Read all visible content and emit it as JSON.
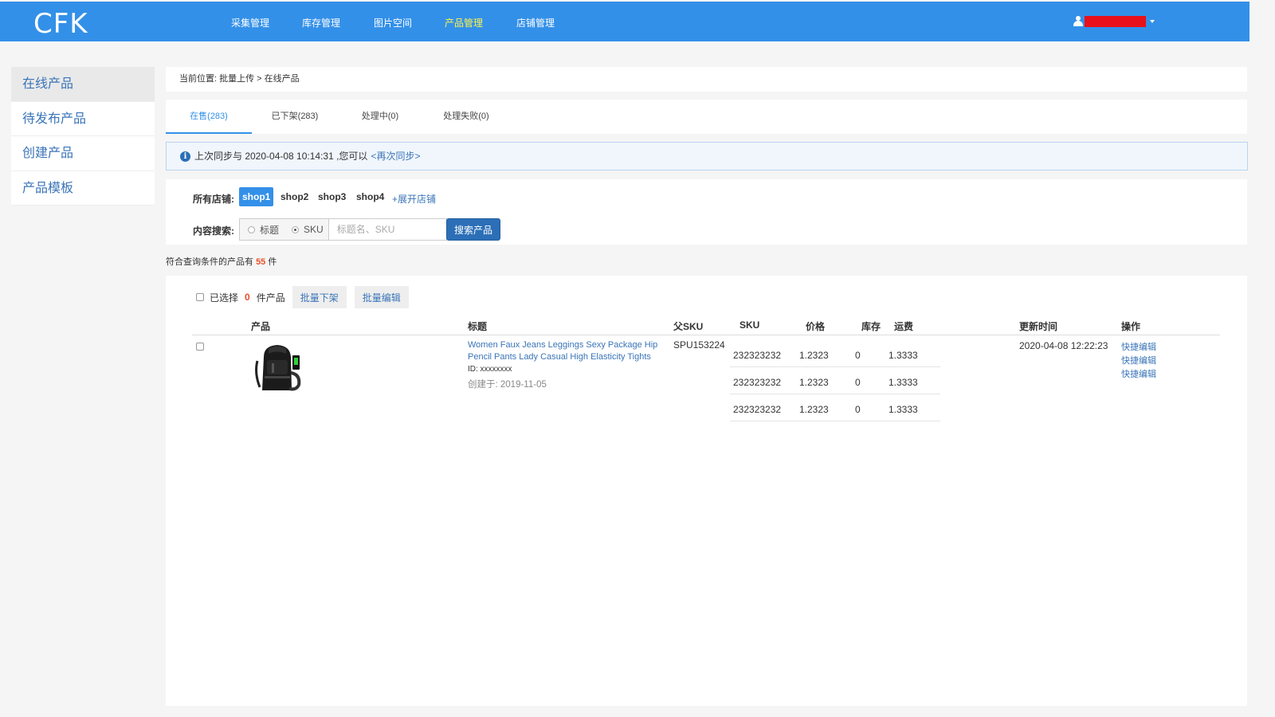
{
  "header": {
    "logo": "CFK",
    "nav": [
      "采集管理",
      "库存管理",
      "图片空间",
      "产品管理",
      "店铺管理"
    ],
    "active_nav": "产品管理"
  },
  "sidebar": {
    "items": [
      {
        "label": "在线产品",
        "active": true
      },
      {
        "label": "待发布产品",
        "active": false
      },
      {
        "label": "创建产品",
        "active": false
      },
      {
        "label": "产品模板",
        "active": false
      }
    ]
  },
  "breadcrumb": "当前位置: 批量上传 > 在线产品",
  "tabs": [
    "在售(283)",
    "已下架(283)",
    "处理中(0)",
    "处理失败(0)"
  ],
  "sync": {
    "icon": "info-icon",
    "text": "上次同步与 2020-04-08 10:14:31 ,您可以",
    "link": "<再次同步>"
  },
  "filters": {
    "shops_label": "所有店铺:",
    "shops": [
      "shop1",
      "shop2",
      "shop3",
      "shop4"
    ],
    "active_shop": "shop1",
    "expand_link": "+展开店铺",
    "search_label": "内容搜索:",
    "radio_title": "标题",
    "radio_sku": "SKU",
    "search_placeholder": "标题名、SKU",
    "search_button": "搜索产品"
  },
  "result": {
    "prefix": "符合查询条件的产品有",
    "count": "55",
    "suffix": "件"
  },
  "table": {
    "selected_prefix": "已选择",
    "selected_count": "0",
    "selected_suffix": "件产品",
    "batch_delist": "批量下架",
    "batch_edit": "批量编辑",
    "headers": {
      "product": "产品",
      "title": "标题",
      "parent_sku": "父SKU",
      "sku": "SKU",
      "price": "价格",
      "stock": "库存",
      "shipping": "运费",
      "updated": "更新时间",
      "action": "操作"
    },
    "rows": [
      {
        "image": "backpack-image",
        "title": "Women Faux Jeans Leggings Sexy Package Hip Pencil Pants Lady Casual High Elasticity Tights",
        "id": "ID: xxxxxxxx",
        "created": "创建于: 2019-11-05",
        "parent_sku": "SPU153224",
        "variants": [
          {
            "sku": "232323232",
            "price": "1.2323",
            "stock": "0",
            "shipping": "1.3333"
          },
          {
            "sku": "232323232",
            "price": "1.2323",
            "stock": "0",
            "shipping": "1.3333"
          },
          {
            "sku": "232323232",
            "price": "1.2323",
            "stock": "0",
            "shipping": "1.3333"
          }
        ],
        "updated": "2020-04-08 12:22:23",
        "actions": [
          "快捷编辑",
          "快捷编辑",
          "快捷编辑"
        ]
      }
    ]
  }
}
